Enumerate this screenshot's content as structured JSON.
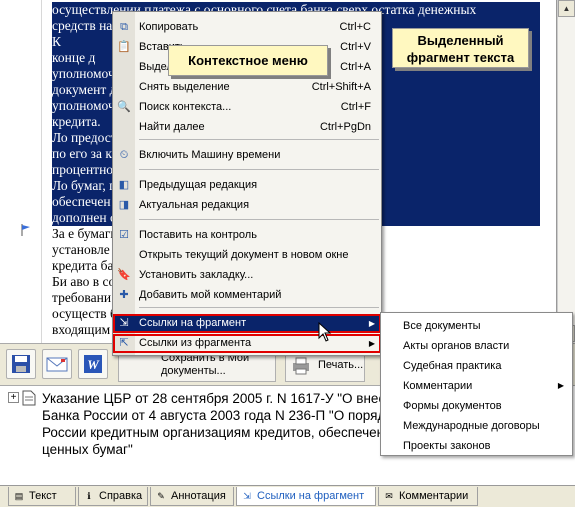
{
  "document": {
    "lines": [
      {
        "text": "осуществлении платежа с основного счета банка сверх остатка денежных",
        "sel": true
      },
      {
        "text": "средств на",
        "sel": true
      },
      {
        "text": "К",
        "sel": true
      },
      {
        "text": "конце д",
        "sel": true
      },
      {
        "text": "уполномоч",
        "sel": true
      },
      {
        "text": "документ документом Банка России/",
        "sel": true
      },
      {
        "text": "уполномоч банком внутридневного",
        "sel": true
      },
      {
        "text": "кредита.",
        "sel": true
      },
      {
        "text": "Ло предоставляемый банку",
        "sel": true
      },
      {
        "text": "по его за кредита по фиксированной",
        "sel": true
      },
      {
        "text": "процентно кредитном аукционе.",
        "sel": true
      },
      {
        "text": "Ло бумаг, принимаемых в",
        "sel": true
      },
      {
        "text": "обеспечен список (изменения и",
        "sel": true
      },
      {
        "text": "дополнен ссии\".",
        "sel": true
      },
      {
        "text": "За е бумаги, отобранные в",
        "sel": false
      },
      {
        "text": "установле ляемого Банком России",
        "sel": false
      },
      {
        "text": "кредита ба",
        "sel": false
      },
      {
        "text": "Би аво в соответствии с",
        "sel": false
      },
      {
        "text": "требовани йской Федерации на",
        "sel": false
      },
      {
        "text": "осуществ бумаг, совершение",
        "sel": false
      },
      {
        "text": "входящим",
        "sel": false
      }
    ]
  },
  "callouts": {
    "context_menu": "Контекстное меню",
    "selected_fragment": "Выделенный фрагмент текста"
  },
  "toolbar": {
    "save_label": "Сохранить в Мои документы...",
    "print_label": "Печать..."
  },
  "result": {
    "lines": [
      "Указание ЦБР от 28 сентября 2005 г. N 1617-У \"О внесе",
      "Банка России от 4 августа 2003 года N 236-П \"О поряд",
      "России кредитным организациям кредитов, обеспеченн",
      "ценных бумаг\""
    ]
  },
  "tabs": [
    {
      "label": "Текст",
      "icon": "text-icon",
      "active": false
    },
    {
      "label": "Справка",
      "icon": "help-icon",
      "active": false
    },
    {
      "label": "Аннотация",
      "icon": "annotation-icon",
      "active": false
    },
    {
      "label": "Ссылки на фрагмент",
      "icon": "links-to-icon",
      "active": true
    },
    {
      "label": "Комментарии",
      "icon": "comments-icon",
      "active": false
    }
  ],
  "context_menu": {
    "items": [
      {
        "label": "Копировать",
        "shortcut": "Ctrl+C",
        "icon": "copy-icon"
      },
      {
        "label": "Вставить",
        "shortcut": "Ctrl+V",
        "icon": "paste-icon"
      },
      {
        "label": "Выделить",
        "shortcut": "Ctrl+A",
        "icon": ""
      },
      {
        "label": "Снять выделение",
        "shortcut": "Ctrl+Shift+A",
        "icon": ""
      },
      {
        "label": "Поиск контекста...",
        "shortcut": "Ctrl+F",
        "icon": "search-icon"
      },
      {
        "label": "Найти далее",
        "shortcut": "Ctrl+PgDn",
        "icon": ""
      },
      {
        "label": "Включить Машину времени",
        "shortcut": "",
        "icon": "time-machine-icon"
      },
      {
        "label": "Предыдущая редакция",
        "shortcut": "",
        "icon": "prev-edition-icon"
      },
      {
        "label": "Актуальная редакция",
        "shortcut": "",
        "icon": "current-edition-icon"
      },
      {
        "label": "Поставить на контроль",
        "shortcut": "",
        "icon": "control-icon"
      },
      {
        "label": "Открыть текущий документ в новом окне",
        "shortcut": "",
        "icon": ""
      },
      {
        "label": "Установить закладку...",
        "shortcut": "",
        "icon": "bookmark-icon"
      },
      {
        "label": "Добавить мой комментарий",
        "shortcut": "",
        "icon": "comment-icon"
      },
      {
        "label": "Ссылки на фрагмент",
        "shortcut": "",
        "icon": "links-to-icon"
      },
      {
        "label": "Ссылки из фрагмента",
        "shortcut": "",
        "icon": "links-from-icon"
      }
    ]
  },
  "submenu": {
    "items": [
      {
        "label": "Все документы",
        "has_arrow": false
      },
      {
        "label": "Акты органов власти",
        "has_arrow": false
      },
      {
        "label": "Судебная практика",
        "has_arrow": false
      },
      {
        "label": "Комментарии",
        "has_arrow": true
      },
      {
        "label": "Формы документов",
        "has_arrow": false
      },
      {
        "label": "Международные договоры",
        "has_arrow": false
      },
      {
        "label": "Проекты законов",
        "has_arrow": false
      }
    ]
  },
  "colors": {
    "selection": "#0a246a",
    "callout_bg": "#fff8c0",
    "highlight_border": "#e00000",
    "active_tab_text": "#1f5fbf"
  }
}
